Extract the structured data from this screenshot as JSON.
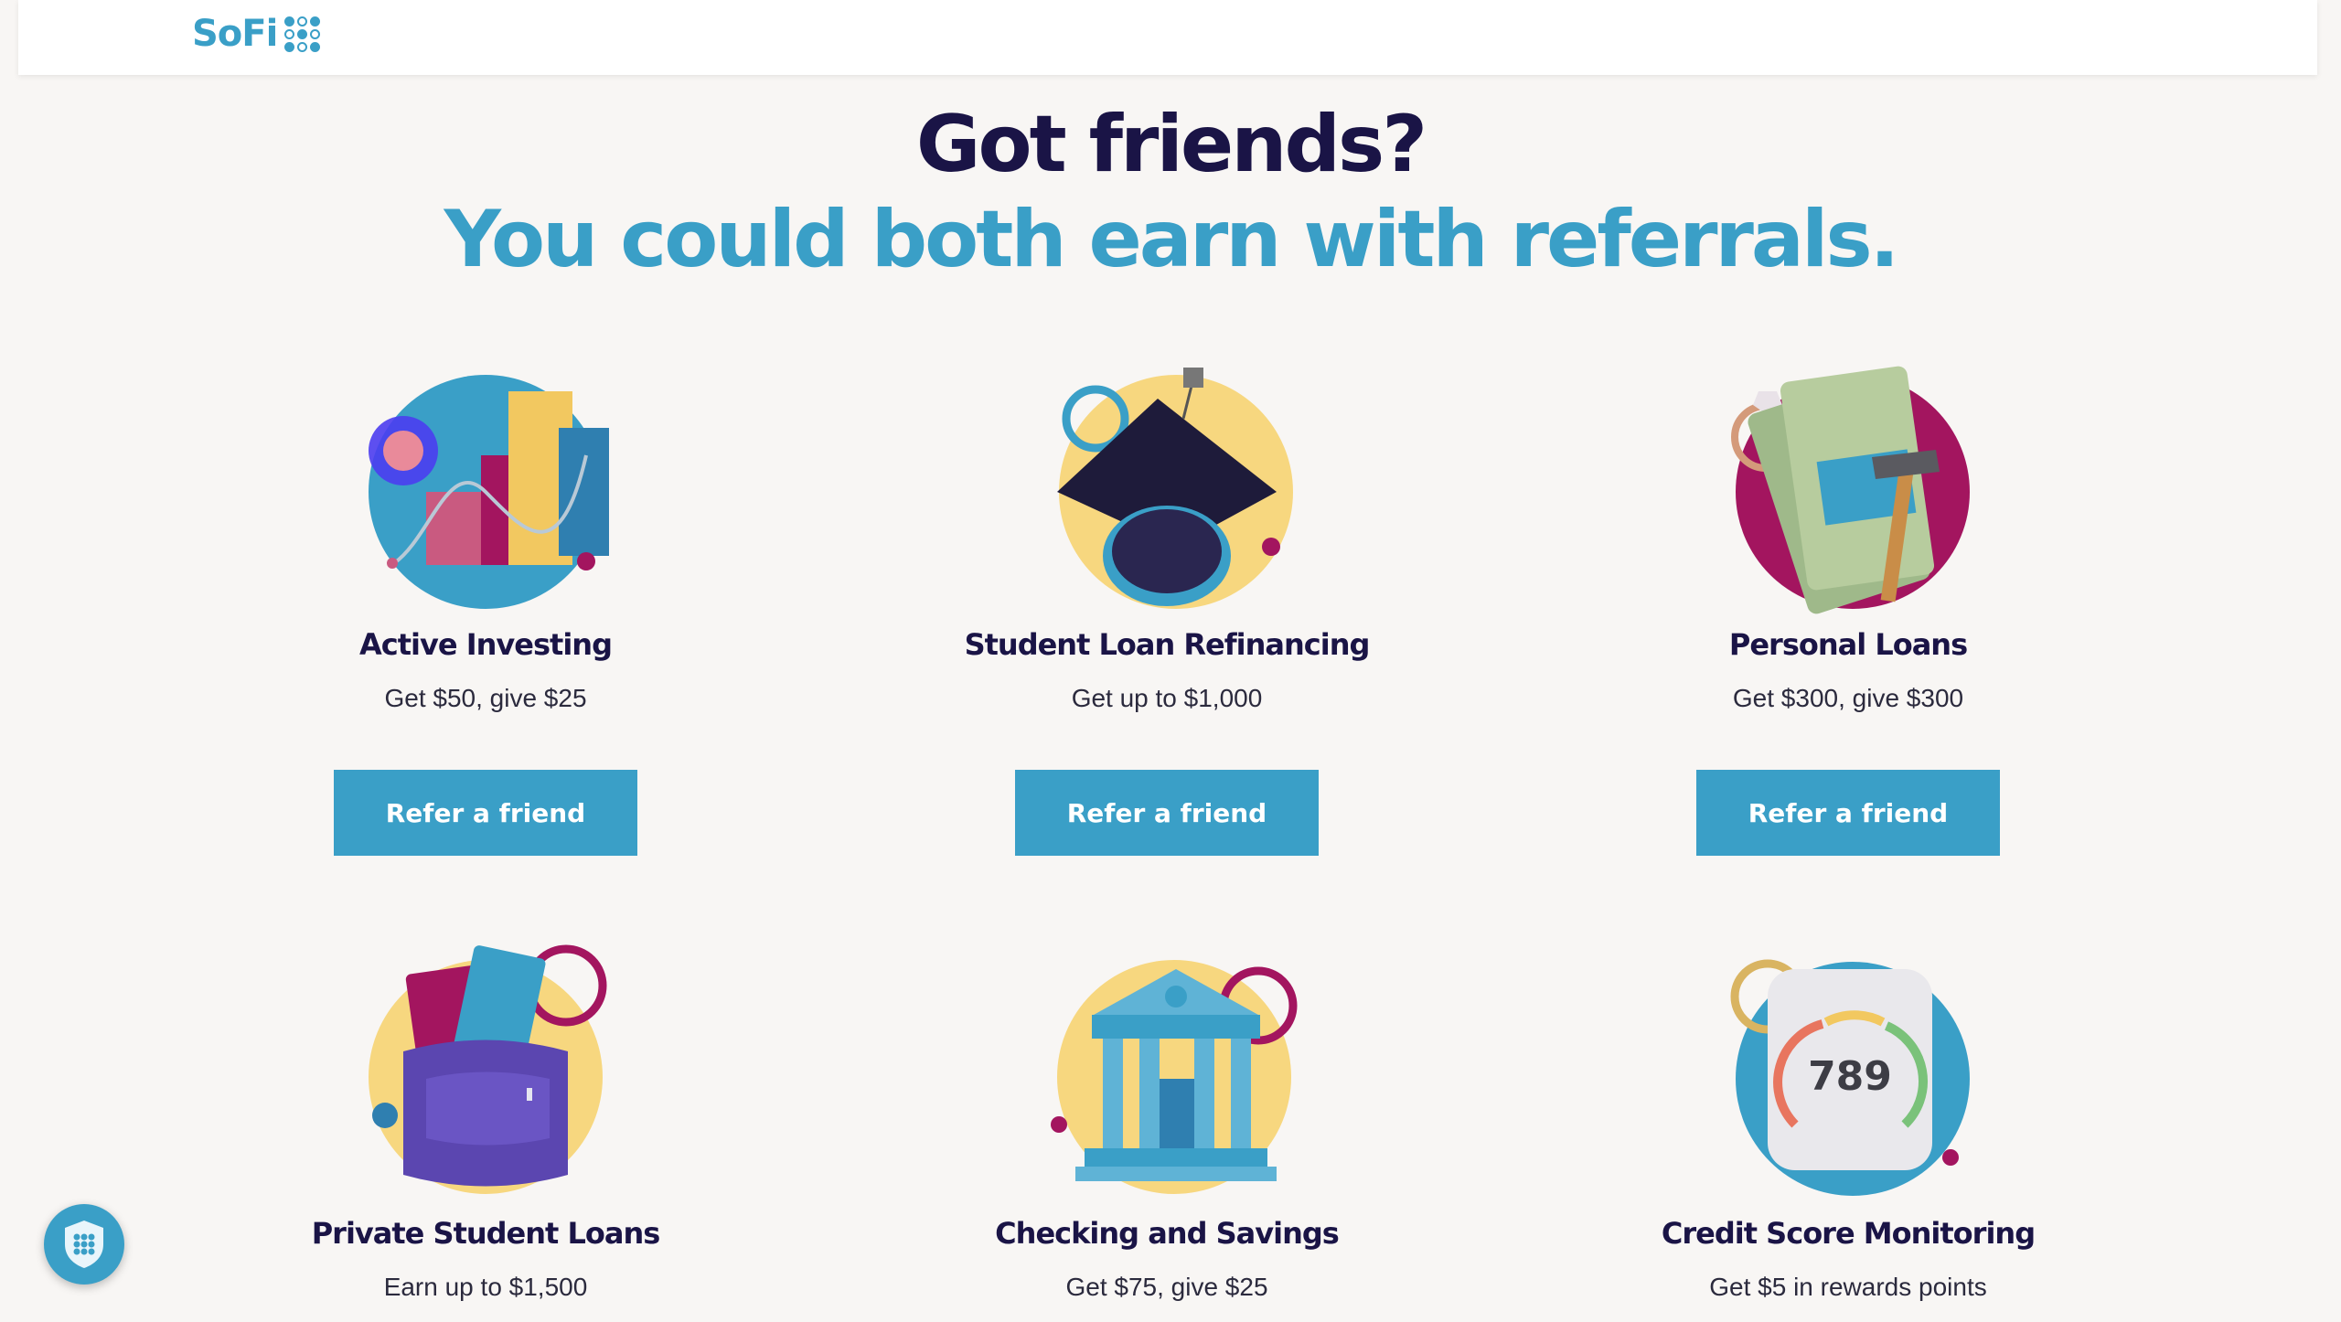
{
  "header": {
    "logo_text": "SoFi"
  },
  "hero": {
    "title": "Got friends?",
    "subtitle": "You could both earn with referrals."
  },
  "products": [
    {
      "name": "Active Investing",
      "offer": "Get $50, give $25",
      "button": "Refer a friend",
      "icon": "investing-chart-icon"
    },
    {
      "name": "Student Loan Refinancing",
      "offer": "Get up to $1,000",
      "button": "Refer a friend",
      "icon": "graduation-cap-icon"
    },
    {
      "name": "Personal Loans",
      "offer": "Get $300, give $300",
      "button": "Refer a friend",
      "icon": "money-ring-hammer-icon"
    },
    {
      "name": "Private Student Loans",
      "offer": "Earn up to $1,500",
      "icon": "backpack-icon"
    },
    {
      "name": "Checking and Savings",
      "offer": "Get $75, give $25",
      "icon": "bank-building-icon"
    },
    {
      "name": "Credit Score Monitoring",
      "offer": "Get $5 in rewards points",
      "icon": "credit-gauge-icon",
      "gauge_value": "789"
    }
  ],
  "colors": {
    "brand_blue": "#3a9fc7",
    "navy": "#1a1446",
    "background": "#f8f6f4",
    "yellow": "#f7d77f",
    "magenta": "#a3155f"
  },
  "widgets": {
    "privacy_shield_icon": "shield-icon"
  }
}
